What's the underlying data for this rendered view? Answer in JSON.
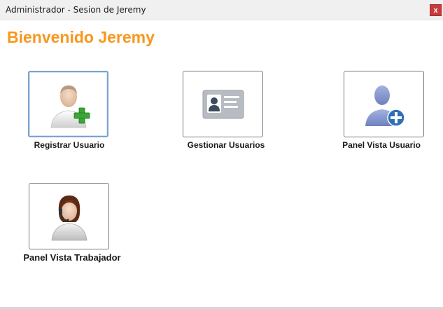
{
  "window": {
    "title": "Administrador - Sesion de Jeremy",
    "close_label": "x"
  },
  "heading": "Bienvenido Jeremy",
  "tiles": [
    {
      "label": "Registrar Usuario",
      "icon": "user-add-icon"
    },
    {
      "label": "Gestionar Usuarios",
      "icon": "id-card-icon"
    },
    {
      "label": "Panel Vista Usuario",
      "icon": "user-plus-circle-icon"
    },
    {
      "label": "Panel Vista Trabajador",
      "icon": "worker-headset-icon"
    }
  ],
  "colors": {
    "accent": "#f7971e",
    "close": "#c73b3b",
    "plus_green": "#3aa635",
    "plus_blue": "#2f6fb5"
  }
}
